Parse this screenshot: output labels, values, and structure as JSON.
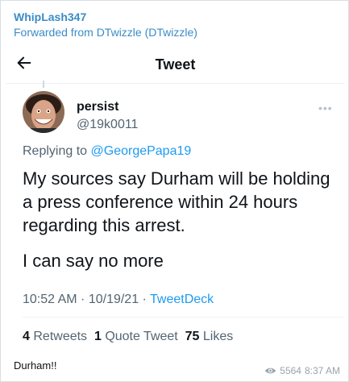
{
  "message": {
    "sender": "WhipLash347",
    "forwarded_from": "Forwarded from DTwizzle (DTwizzle)",
    "caption": "Durham!!",
    "views": "5564",
    "time": "8:37 AM"
  },
  "tweet_screen": {
    "header_title": "Tweet",
    "author": {
      "display_name": "persist",
      "handle": "@19k0011"
    },
    "reply_prefix": "Replying to",
    "reply_to": "@GeorgePapa19",
    "text_line1": "My sources say Durham will be holding a press conference within 24 hours regarding this arrest.",
    "text_line2": "I can say no more",
    "timestamp": "10:52 AM · 10/19/21 · ",
    "source": "TweetDeck",
    "stats": {
      "retweets_count": "4",
      "retweets_label": "Retweets",
      "quotes_count": "1",
      "quotes_label": "Quote Tweet",
      "likes_count": "75",
      "likes_label": "Likes"
    }
  },
  "icons": {
    "back": "back-arrow-icon",
    "more": "more-options-icon",
    "views": "eye-icon"
  },
  "colors": {
    "telegram_name": "#3a8cc7",
    "twitter_link": "#1d9bf0",
    "muted": "#536471"
  }
}
